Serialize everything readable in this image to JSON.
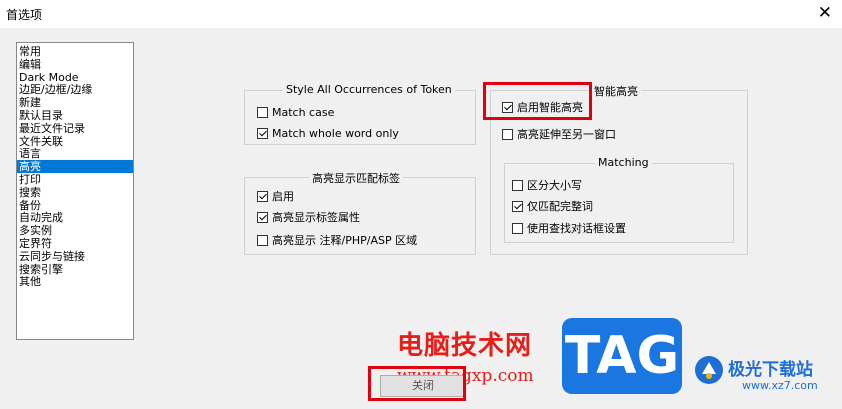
{
  "window": {
    "title": "首选项",
    "close_symbol": "✕"
  },
  "categories": {
    "items": [
      "常用",
      "编辑",
      "Dark Mode",
      "边距/边框/边缘",
      "新建",
      "默认目录",
      "最近文件记录",
      "文件关联",
      "语言",
      "高亮",
      "打印",
      "搜索",
      "备份",
      "自动完成",
      "多实例",
      "定界符",
      "云同步与链接",
      "搜索引擎",
      "其他"
    ],
    "selected_index": 9
  },
  "token_group": {
    "legend": "Style All Occurrences of Token",
    "match_case": {
      "label": "Match case",
      "checked": false
    },
    "match_whole_word": {
      "label": "Match whole word only",
      "checked": true
    }
  },
  "tag_group": {
    "legend": "高亮显示匹配标签",
    "enable": {
      "label": "启用",
      "checked": true
    },
    "attributes": {
      "label": "高亮显示标签属性",
      "checked": true
    },
    "comment_zone": {
      "label": "高亮显示 注释/PHP/ASP 区域",
      "checked": false
    }
  },
  "smart_group": {
    "legend": "智能高亮",
    "enable": {
      "label": "启用智能高亮",
      "checked": true
    },
    "extend": {
      "label": "高亮延伸至另一窗口",
      "checked": false
    },
    "matching": {
      "legend": "Matching",
      "case_sensitive": {
        "label": "区分大小写",
        "checked": false
      },
      "whole_word": {
        "label": "仅匹配完整词",
        "checked": true
      },
      "use_find_dialog": {
        "label": "使用查找对话框设置",
        "checked": false
      }
    }
  },
  "footer": {
    "close_label": "关闭"
  },
  "watermark": {
    "cn_text": "电脑技术网",
    "url": "www.tagxp.com",
    "tag": "TAG",
    "site_name": "极光下载站",
    "site_url": "www.xz7.com"
  },
  "colors": {
    "selection": "#0078d7",
    "highlight_box": "#e0000f",
    "watermark_red": "#e41f19",
    "watermark_blue": "#1a76e0"
  }
}
